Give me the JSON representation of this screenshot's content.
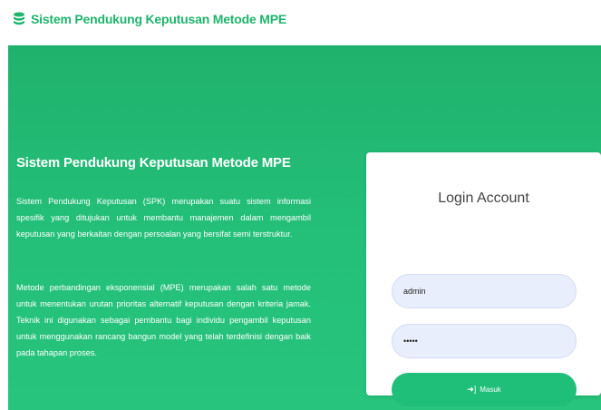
{
  "navbar": {
    "brand_icon": "database-icon",
    "brand_title": "Sistem Pendukung Keputusan Metode MPE",
    "accent_color": "#1eb56d"
  },
  "hero": {
    "title": "Sistem Pendukung Keputusan Metode MPE",
    "paragraph_1": "Sistem Pendukung Keputusan (SPK) merupakan suatu sistem informasi spesifik yang ditujukan untuk membantu manajemen dalam mengambil keputusan yang berkaitan dengan persoalan yang bersifat semi terstruktur.",
    "paragraph_2": "Metode perbandingan eksponensial (MPE) merupakan salah satu metode untuk menentukan urutan prioritas alternatif keputusan dengan kriteria jamak. Teknik ini digunakan sebagai pembantu bagi individu pengambil keputusan untuk menggunakan rancang bangun model yang telah terdefinisi dengan baik pada tahapan proses.",
    "background_color": "#24c07a"
  },
  "login": {
    "title": "Login Account",
    "username_value": "admin",
    "password_value": "•••••",
    "submit_icon": "sign-in-icon",
    "submit_label": "Masuk",
    "button_color": "#1fbe79"
  }
}
